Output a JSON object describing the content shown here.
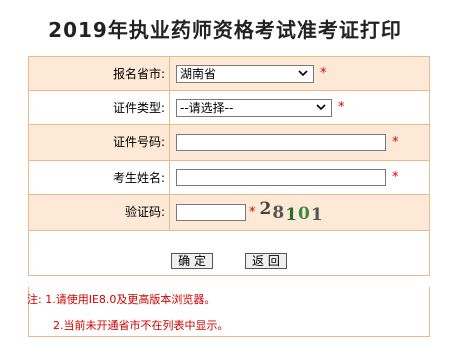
{
  "page": {
    "title": "2019年执业药师资格考试准考证打印"
  },
  "form": {
    "province_label": "报名省市:",
    "province_value": "湖南省",
    "id_type_label": "证件类型:",
    "id_type_value": "--请选择--",
    "id_number_label": "证件号码:",
    "id_number_value": "",
    "name_label": "考生姓名:",
    "name_value": "",
    "captcha_label": "验证码:",
    "captcha_value": "",
    "captcha_image_text": "28101",
    "required_mark": "*"
  },
  "buttons": {
    "confirm": "确 定",
    "back": "返 回"
  },
  "notes": {
    "line1": "注: 1.请使用IE8.0及更高版本浏览器。",
    "line2": "2.当前未开通省市不在列表中显示。"
  }
}
